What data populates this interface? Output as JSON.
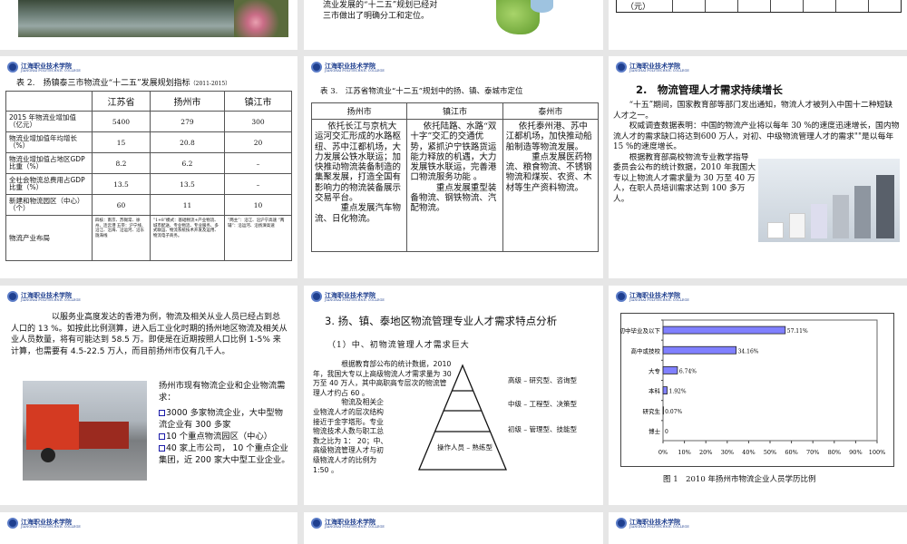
{
  "logo": {
    "name": "江海职业技术学院",
    "english": "JIANGHAI POLYTECHNIC COLLEGE"
  },
  "top_row": {
    "slide2_text": [
      "流业发展的“十二五”规划已经对",
      "三市做出了明确分工和定位。"
    ],
    "slide3_cell": "（元）"
  },
  "slide_table2": {
    "caption": "表 2.　扬镇泰三市物流业“十二五”发展规划指标",
    "caption_years": "（2011-2015）",
    "headers": [
      "",
      "江苏省",
      "扬州市",
      "镇江市"
    ],
    "rows": [
      [
        "2015 年物流业增加值（亿元）",
        "5400",
        "279",
        "300"
      ],
      [
        "物流业增加值年均增长（%）",
        "15",
        "20.8",
        "20"
      ],
      [
        "物流业增加值占地区GDP 比重（%）",
        "8.2",
        "6.2",
        "–"
      ],
      [
        "全社会物流总费用占GDP 比重（%）",
        "13.5",
        "13.5",
        "–"
      ],
      [
        "新建和物流园区（中心）（个）",
        "60",
        "11",
        "10"
      ],
      [
        "物流产业布局",
        "四核：南京、苏锡常、徐州、连云港 五带：沪宁线、沿江、沿海、沿运河、沿东陇海线",
        "“1+8”模式：基础物流+产业物流、城市配送、专业物流、专业服务、多式联运、物流系统技术开发及运用、物流电子商务。",
        "“两主”：沿江、沿沪宁高速 “两辅”：沿运河、沿扬溧高速"
      ]
    ]
  },
  "slide_table3": {
    "caption": "表 3.　江苏省物流业“十二五”规划中的扬、镇、泰城市定位",
    "headers": [
      "扬州市",
      "镇江市",
      "泰州市"
    ],
    "cells": [
      [
        "依托长江与京杭大运河交汇形成的水路枢纽、苏中江都机场，大力发展公铁水联运；加快推动物流装备制造的集聚发展，打造全国有影响力的物流装备展示交易平台。",
        "重点发展汽车物流、日化物流。"
      ],
      [
        "依托陆路、水路“双十字”交汇的交通优势，紧抓沪宁铁路货运能力释放的机遇，大力发展铁水联运，完善港口物流服务功能 。",
        "重点发展重型装备物流、钢铁物流、汽配物流。"
      ],
      [
        "依托泰州港、苏中江都机场，加快推动船舶制造等物流发展。",
        "重点发展医药物流、粮食物流、不锈钢物流和煤炭、农资、木材等生产资料物流。"
      ]
    ]
  },
  "slide_growth": {
    "title": "2.　物流管理人才需求持续增长",
    "paragraphs": [
      "“十五”期间，国家教育部等部门发出通知，物流人才被列入中国十二种短缺人才之一。",
      "权威调查数据表明：中国的物流产业将以每年 30 %的速度迅速增长，国内物流人才的需求缺口将达到600 万人，对初、中级物流管理人才的需求\"\"是以每年 15 %的速度增长。",
      "根据教育部高校物流专业教学指导委员会公布的统计数据，2010 年我国大专以上物流人才需求量为 30 万至 40 万人，在职人员培训需求达到 100 多万人。"
    ]
  },
  "slide_hk": {
    "paragraph": "以服务业高度发达的香港为例，物流及相关从业人员已经占到总人口的 13 %。如按此比例测算，进入后工业化时期的扬州地区物流及相关从业人员数量，将有可能达到 58.5 万。即使是在近期按照人口比例 1-5% 来计算，也需要有 4.5-22.5 万人，而目前扬州市仅有几千人。",
    "side_title": "扬州市现有物流企业和企业物流需求：",
    "bullets": [
      "3000 多家物流企业，大中型物流企业有 300 多家",
      "10 个重点物流园区（中心）",
      "40 家上市公司， 10 个重点企业集团，近 200 家大中型工业企业。"
    ]
  },
  "slide_pyramid": {
    "title": "3. 扬、镇、泰地区物流管理专业人才需求特点分析",
    "subtitle": "（1）中、初物流管理人才需求巨大",
    "para1": "根据教育部公布的统计数据，2010 年，我国大专以上高级物流人才需求量为 30 万至 40 万人，其中高职高专层次的物流管理人才约占 60 。",
    "para2": "物流及相关企业物流人才的层次结构接近于金字塔形。专业物流技术人数与职工总数之比为 1： 20；中、高级物流管理人才与初级物流人才的比例为 1:50 。",
    "levels": [
      "高级 – 研究型、咨询型",
      "中级 – 工程型、决策型",
      "初级 – 管理型、技能型",
      "操作人员 – 熟练型"
    ]
  },
  "chart_data": {
    "type": "bar",
    "orientation": "horizontal",
    "title": "图 1　2010 年扬州市物流企业人员学历比例",
    "categories": [
      "初中毕业及以下",
      "高中或技校",
      "大专",
      "本科",
      "研究生",
      "博士"
    ],
    "values": [
      57.11,
      34.16,
      6.74,
      1.92,
      0.07,
      0
    ],
    "value_labels": [
      "57.11%",
      "34.16%",
      "6.74%",
      "1.92%",
      "0.07%",
      "0"
    ],
    "xlim": [
      0,
      100
    ],
    "xticks": [
      "0%",
      "10%",
      "20%",
      "30%",
      "40%",
      "50%",
      "60%",
      "70%",
      "80%",
      "90%",
      "100%"
    ],
    "bar_color": "#8080ff",
    "grid": false
  }
}
